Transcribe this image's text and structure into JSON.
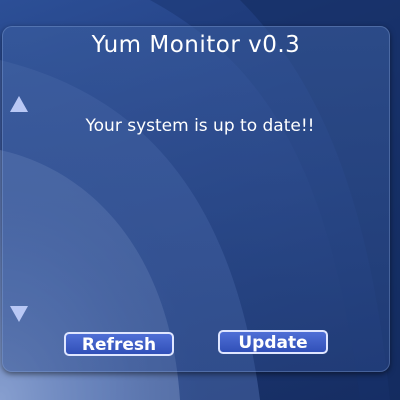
{
  "widget": {
    "title": "Yum Monitor v0.3",
    "status_message": "Your system is up to date!!",
    "scroll_up_icon": "triangle-up-icon",
    "scroll_down_icon": "triangle-down-icon"
  },
  "buttons": {
    "refresh_label": "Refresh",
    "update_label": "Update"
  },
  "colors": {
    "background": "#1d3a78",
    "button_fill": "#3f5fcb",
    "button_border": "#dfe6ff",
    "text": "#ffffff"
  }
}
